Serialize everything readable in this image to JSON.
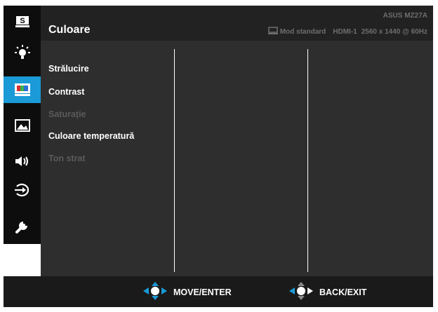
{
  "header": {
    "title": "Culoare",
    "model": "ASUS MZ27A",
    "mode": "Mod standard",
    "input": "HDMI-1",
    "resolution": "2560 x 1440 @ 60Hz"
  },
  "sidebar": {
    "items": [
      {
        "icon": "splendid-icon",
        "active": false
      },
      {
        "icon": "brightness-icon",
        "active": false
      },
      {
        "icon": "color-icon",
        "active": true
      },
      {
        "icon": "image-icon",
        "active": false
      },
      {
        "icon": "sound-icon",
        "active": false
      },
      {
        "icon": "input-select-icon",
        "active": false
      },
      {
        "icon": "system-setup-icon",
        "active": false
      }
    ]
  },
  "menu": {
    "items": [
      {
        "label": "Strălucire",
        "enabled": true
      },
      {
        "label": "Contrast",
        "enabled": true
      },
      {
        "label": "Saturație",
        "enabled": false
      },
      {
        "label": "Culoare temperatură",
        "enabled": true
      },
      {
        "label": "Ton strat",
        "enabled": false
      }
    ]
  },
  "footer": {
    "move_label": "MOVE/ENTER",
    "back_label": "BACK/EXIT"
  },
  "colors": {
    "accent": "#1a9ad6",
    "panel": "#2e2e2e",
    "header": "#222222",
    "sidebar": "#0d0d0d",
    "disabled_text": "#5a5a5a"
  }
}
